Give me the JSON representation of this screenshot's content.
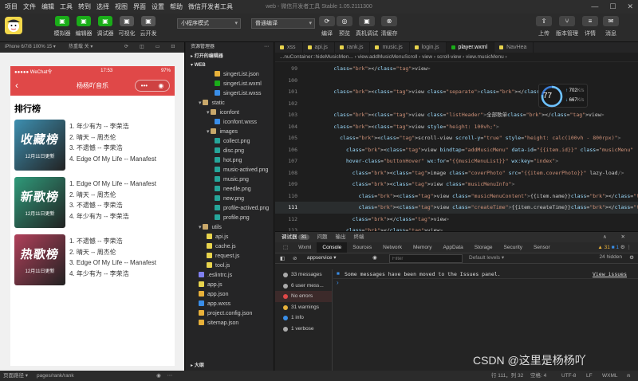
{
  "menu": [
    "项目",
    "文件",
    "编辑",
    "工具",
    "转到",
    "选择",
    "视图",
    "界面",
    "设置",
    "帮助",
    "微信开发者工具"
  ],
  "window_title": "web - 微信开发者工具 Stable 1.05.2111300",
  "toolbar": {
    "modes": [
      {
        "label": "模拟器",
        "color": "#1aad19"
      },
      {
        "label": "编辑器",
        "color": "#1aad19"
      },
      {
        "label": "调试器",
        "color": "#1aad19"
      },
      {
        "label": "可视化",
        "color": "#555555"
      },
      {
        "label": "云开发",
        "color": "#555555"
      }
    ],
    "compile_mode": "小程序模式",
    "compile_type": "普通编译",
    "actions": [
      "编译",
      "预览",
      "真机调试",
      "清缓存"
    ],
    "right": [
      "上传",
      "版本管理",
      "详情",
      "消息"
    ]
  },
  "simulator": {
    "device": "iPhone 6/7/8 100% 15 ▾",
    "hotreload": "热重载 关 ▾",
    "statusbar": {
      "carrier": "●●●●● WeChat令",
      "time": "17:53",
      "battery": "97%"
    },
    "nav_title": "杨杨吖音乐",
    "rank_title": "排行榜",
    "lists": [
      {
        "name": "收藏榜",
        "date": "12月11日更新",
        "color": "#3d8fb0",
        "songs": [
          "1. 年少有为 -- 李荣浩",
          "2. 晴天 -- 周杰伦",
          "3. 不遗憾 -- 李荣浩",
          "4. Edge Of My Life -- Manafest"
        ]
      },
      {
        "name": "新歌榜",
        "date": "12月11日更新",
        "color": "#2f9a7a",
        "songs": [
          "1. Edge Of My Life -- Manafest",
          "2. 晴天 -- 周杰伦",
          "3. 不遗憾 -- 李荣浩",
          "4. 年少有为 -- 李荣浩"
        ]
      },
      {
        "name": "热歌榜",
        "date": "12月11日更新",
        "color": "#b0405a",
        "songs": [
          "1. 不遗憾 -- 李荣浩",
          "2. 晴天 -- 周杰伦",
          "3. Edge Of My Life -- Manafest",
          "4. 年少有为 -- 李荣浩"
        ]
      }
    ]
  },
  "explorer": {
    "title": "资源管理器",
    "open_editors": "打开的编辑器",
    "root": "WEB",
    "outline": "大纲",
    "files": [
      {
        "name": "singerList.json",
        "depth": 2,
        "kind": "json"
      },
      {
        "name": "singerList.wxml",
        "depth": 2,
        "kind": "wxml"
      },
      {
        "name": "singerList.wxss",
        "depth": 2,
        "kind": "wxss"
      },
      {
        "name": "static",
        "depth": 0,
        "kind": "folder"
      },
      {
        "name": "iconfont",
        "depth": 1,
        "kind": "folder"
      },
      {
        "name": "iconfont.wxss",
        "depth": 2,
        "kind": "wxss"
      },
      {
        "name": "images",
        "depth": 1,
        "kind": "folder"
      },
      {
        "name": "collect.png",
        "depth": 2,
        "kind": "png"
      },
      {
        "name": "disc.png",
        "depth": 2,
        "kind": "png"
      },
      {
        "name": "hot.png",
        "depth": 2,
        "kind": "png"
      },
      {
        "name": "music-actived.png",
        "depth": 2,
        "kind": "png"
      },
      {
        "name": "music.png",
        "depth": 2,
        "kind": "png"
      },
      {
        "name": "needle.png",
        "depth": 2,
        "kind": "png"
      },
      {
        "name": "new.png",
        "depth": 2,
        "kind": "png"
      },
      {
        "name": "profile-actived.png",
        "depth": 2,
        "kind": "png"
      },
      {
        "name": "profile.png",
        "depth": 2,
        "kind": "png"
      },
      {
        "name": "utils",
        "depth": 0,
        "kind": "folder"
      },
      {
        "name": "api.js",
        "depth": 1,
        "kind": "js"
      },
      {
        "name": "cache.js",
        "depth": 1,
        "kind": "js"
      },
      {
        "name": "request.js",
        "depth": 1,
        "kind": "js"
      },
      {
        "name": "tool.js",
        "depth": 1,
        "kind": "js"
      },
      {
        "name": ".eslintrc.js",
        "depth": 0,
        "kind": "eslint"
      },
      {
        "name": "app.js",
        "depth": 0,
        "kind": "js"
      },
      {
        "name": "app.json",
        "depth": 0,
        "kind": "json"
      },
      {
        "name": "app.wxss",
        "depth": 0,
        "kind": "wxss"
      },
      {
        "name": "project.config.json",
        "depth": 0,
        "kind": "json"
      },
      {
        "name": "sitemap.json",
        "depth": 0,
        "kind": "json"
      }
    ]
  },
  "editor": {
    "tabs": [
      {
        "name": "xss",
        "active": false
      },
      {
        "name": "api.js",
        "active": false
      },
      {
        "name": "rank.js",
        "active": false
      },
      {
        "name": "music.js",
        "active": false
      },
      {
        "name": "login.js",
        "active": false
      },
      {
        "name": "player.wxml",
        "active": true
      },
      {
        "name": "NavHea",
        "active": false
      }
    ],
    "breadcrumb": "...nuContainer::hideMusicMen...  ›  view.addMusicMenuScroll  ›  view  ›  scroll-view  ›  view.musicMenu  ›",
    "lines": [
      {
        "num": "99",
        "text": "        </view>"
      },
      {
        "num": "100",
        "text": ""
      },
      {
        "num": "101",
        "text": "        <view class=\"separate\"></view>"
      },
      {
        "num": "102",
        "text": ""
      },
      {
        "num": "103",
        "text": "        <view class=\"listHeader\">全部歌单</view>"
      },
      {
        "num": "104",
        "text": "        <view style=\"height: 100vh;\">"
      },
      {
        "num": "105",
        "text": "          <scroll-view scroll-y=\"true\" style=\"height: calc(100vh - 800rpx)\">"
      },
      {
        "num": "106",
        "text": "            <view bindtap=\"addMusicMenu\" data-id=\"{{item.id}}\" class=\"musicMenu\""
      },
      {
        "num": "107",
        "text": "            hover-class=\"buttonHover\" wx:for=\"{{musicMenuList}}\" wx:key=\"index\">"
      },
      {
        "num": "108",
        "text": "              <image class=\"coverPhoto\" src=\"{{item.coverPhoto}}\" lazy-load/>"
      },
      {
        "num": "109",
        "text": "              <view class=\"musicMenuInfo\">"
      },
      {
        "num": "110",
        "text": "                <view class=\"musicMenuContent\">{{item.name}}</view>"
      },
      {
        "num": "111",
        "text": "                <view class=\"createTime\">{{item.createTime}}</view>"
      },
      {
        "num": "112",
        "text": "              </view>"
      },
      {
        "num": "113",
        "text": "            </view>"
      }
    ],
    "perf": {
      "score": "77",
      "label1": "702",
      "unit1": "K/s",
      "label2": "667",
      "unit2": "K/s"
    }
  },
  "devtools": {
    "tabs": [
      "调试器",
      "31",
      "问题",
      "输出",
      "终端"
    ],
    "panels": [
      "Wxml",
      "Console",
      "Sources",
      "Network",
      "Memory",
      "AppData",
      "Storage",
      "Security",
      "Sensor"
    ],
    "warn_count": "31",
    "info_count": "1",
    "context": "appservice",
    "filter_placeholder": "Filter",
    "levels": "Default levels",
    "hidden": "24 hidden",
    "sidebar": [
      {
        "label": "33 messages",
        "color": "#aaaaaa"
      },
      {
        "label": "6 user mess...",
        "color": "#aaaaaa"
      },
      {
        "label": "No errors",
        "color": "#e04848"
      },
      {
        "label": "31 warnings",
        "color": "#e8b13a"
      },
      {
        "label": "1 info",
        "color": "#3a8ee8"
      },
      {
        "label": "1 verbose",
        "color": "#aaaaaa"
      }
    ],
    "message": "Some messages have been moved to the Issues panel.",
    "view_issues": "View issues"
  },
  "statusbar": {
    "path_label": "页面路径 ▾",
    "path": "pages/rank/rank",
    "position": "行 111，列 32",
    "spaces": "空格: 4",
    "encoding": "UTF-8",
    "eol": "LF",
    "lang": "WXML"
  },
  "watermark": "CSDN @这里是杨杨吖"
}
